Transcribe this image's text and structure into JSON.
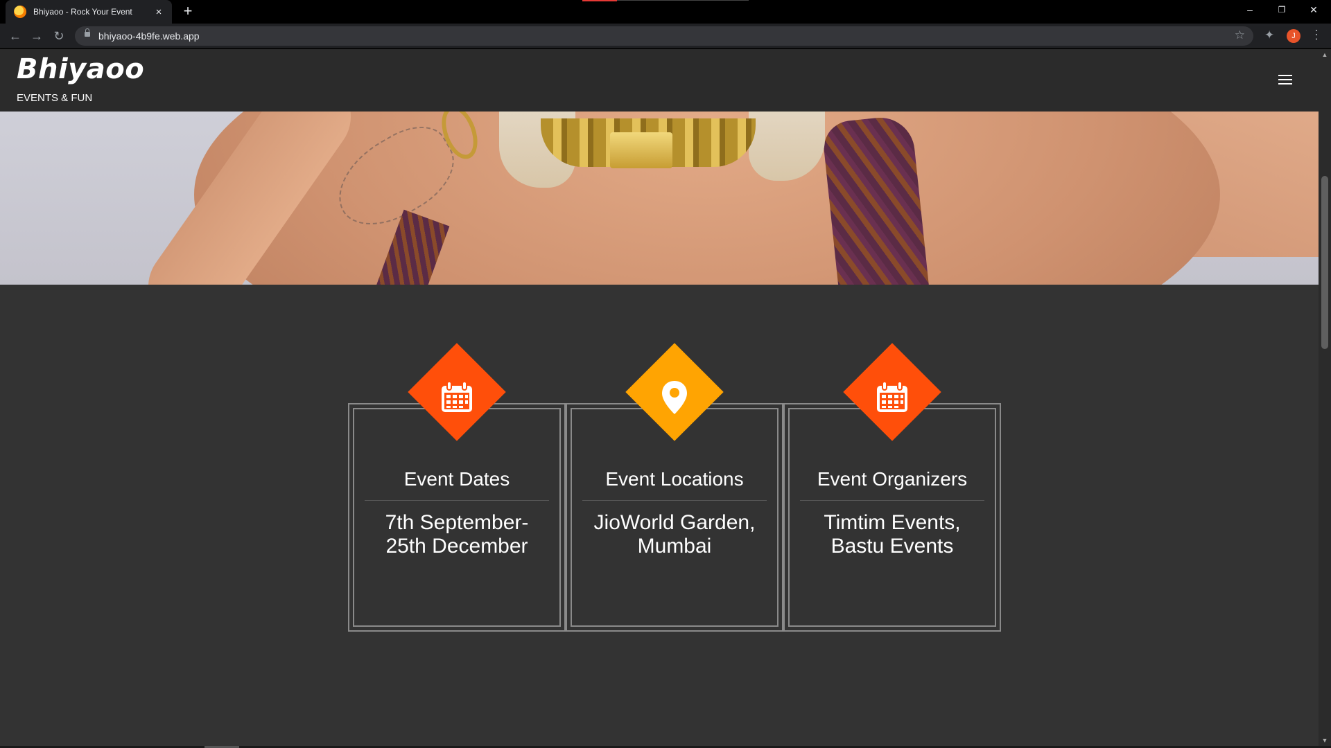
{
  "browser": {
    "tab_title": "Bhiyaoo - Rock Your Event",
    "tab_close": "×",
    "new_tab": "+",
    "url": "bhiyaoo-4b9fe.web.app",
    "avatar_letter": "J",
    "window_controls": {
      "minimize": "–",
      "restore": "❐",
      "close": "✕"
    }
  },
  "site": {
    "brand": "Bhiyaoo",
    "tagline": "EVENTS & FUN"
  },
  "features": [
    {
      "icon": "calendar-icon",
      "color": "#ff4f0a",
      "title": "Event Dates",
      "line1": "7th September-",
      "line2": "25th December"
    },
    {
      "icon": "location-pin-icon",
      "color": "#ffa402",
      "title": "Event Locations",
      "line1": "JioWorld Garden,",
      "line2": "Mumbai"
    },
    {
      "icon": "calendar-icon",
      "color": "#ff4f0a",
      "title": "Event Organizers",
      "line1": "Timtim Events,",
      "line2": "Bastu Events"
    }
  ],
  "colors": {
    "page_background": "#333333",
    "header_background": "#2b2b2b",
    "accent_orange_red": "#ff4f0a",
    "accent_amber": "#ffa402",
    "card_border": "#8a8a8a"
  }
}
